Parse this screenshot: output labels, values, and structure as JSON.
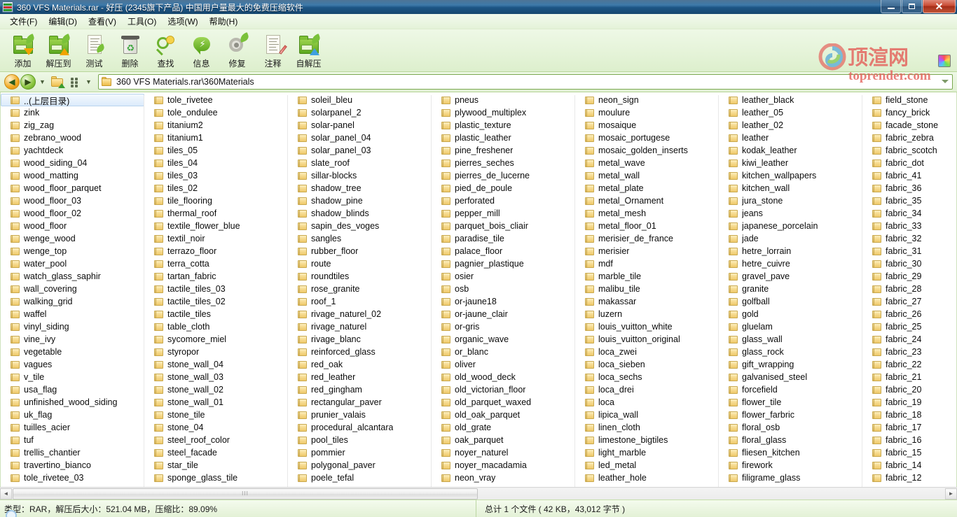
{
  "window": {
    "title": "360 VFS Materials.rar - 好压 (2345旗下产品) 中国用户量最大的免费压缩软件",
    "app_icon": "archive-icon",
    "minimize_label": "",
    "maximize_label": "",
    "close_label": "✕"
  },
  "menu": {
    "items": [
      {
        "label": "文件(F)",
        "name": "menu-file"
      },
      {
        "label": "编辑(D)",
        "name": "menu-edit"
      },
      {
        "label": "查看(V)",
        "name": "menu-view"
      },
      {
        "label": "工具(O)",
        "name": "menu-tools"
      },
      {
        "label": "选项(W)",
        "name": "menu-options"
      },
      {
        "label": "帮助(H)",
        "name": "menu-help"
      }
    ]
  },
  "toolbar": {
    "buttons": [
      {
        "label": "添加",
        "icon": "add-to-archive-icon"
      },
      {
        "label": "解压到",
        "icon": "extract-to-icon"
      },
      {
        "label": "测试",
        "icon": "test-archive-icon"
      },
      {
        "label": "删除",
        "icon": "delete-trash-icon"
      },
      {
        "label": "查找",
        "icon": "find-search-icon"
      },
      {
        "label": "信息",
        "icon": "info-icon"
      },
      {
        "label": "修复",
        "icon": "repair-gear-icon"
      },
      {
        "label": "注释",
        "icon": "comment-pencil-icon"
      },
      {
        "label": "自解压",
        "icon": "sfx-icon"
      }
    ],
    "right_icon": "color-palette-icon"
  },
  "watermark": {
    "text_cn": "顶渲网",
    "text_en": "toprender.com",
    "color": "#e4625c"
  },
  "address_bar": {
    "back_icon": "back-arrow-icon",
    "forward_icon": "forward-arrow-icon",
    "history_icon": "chevron-down-icon",
    "up_folder_icon": "up-one-level-icon",
    "view_mode_icon": "view-mode-icon",
    "path": "360 VFS Materials.rar\\360Materials",
    "dropdown_icon": "chevron-down-icon"
  },
  "file_list": {
    "columns": [
      {
        "name": "column-1",
        "items": [
          "..(上层目录)",
          "zink",
          "zig_zag",
          "zebrano_wood",
          "yachtdeck",
          "wood_siding_04",
          "wood_matting",
          "wood_floor_parquet",
          "wood_floor_03",
          "wood_floor_02",
          "wood_floor",
          "wenge_wood",
          "wenge_top",
          "water_pool",
          "watch_glass_saphir",
          "wall_covering",
          "walking_grid",
          "waffel",
          "vinyl_siding",
          "vine_ivy",
          "vegetable",
          "vagues",
          "v_tile",
          "usa_flag",
          "unfinished_wood_siding",
          "uk_flag",
          "tuilles_acier",
          "tuf",
          "trellis_chantier",
          "travertino_bianco",
          "tole_rivetee_03"
        ]
      },
      {
        "name": "column-2",
        "items": [
          "tole_rivetee",
          "tole_ondulee",
          "titanium2",
          "titanium1",
          "tiles_05",
          "tiles_04",
          "tiles_03",
          "tiles_02",
          "tile_flooring",
          "thermal_roof",
          "textile_flower_blue",
          "textil_noir",
          "terrazo_floor",
          "terra_cotta",
          "tartan_fabric",
          "tactile_tiles_03",
          "tactile_tiles_02",
          "tactile_tiles",
          "table_cloth",
          "sycomore_miel",
          "styropor",
          "stone_wall_04",
          "stone_wall_03",
          "stone_wall_02",
          "stone_wall_01",
          "stone_tile",
          "stone_04",
          "steel_roof_color",
          "steel_facade",
          "star_tile",
          "sponge_glass_tile"
        ]
      },
      {
        "name": "column-3",
        "items": [
          "soleil_bleu",
          "solarpanel_2",
          "solar-panel",
          "solar_panel_04",
          "solar_panel_03",
          "slate_roof",
          "sillar-blocks",
          "shadow_tree",
          "shadow_pine",
          "shadow_blinds",
          "sapin_des_voges",
          "sangles",
          "rubber_floor",
          "route",
          "roundtiles",
          "rose_granite",
          "roof_1",
          "rivage_naturel_02",
          "rivage_naturel",
          "rivage_blanc",
          "reinforced_glass",
          "red_oak",
          "red_leather",
          "red_gingham",
          "rectangular_paver",
          "prunier_valais",
          "procedural_alcantara",
          "pool_tiles",
          "pommier",
          "polygonal_paver",
          "poele_tefal"
        ]
      },
      {
        "name": "column-4",
        "items": [
          "pneus",
          "plywood_multiplex",
          "plastic_texture",
          "plastic_leather",
          "pine_freshener",
          "pierres_seches",
          "pierres_de_lucerne",
          "pied_de_poule",
          "perforated",
          "pepper_mill",
          "parquet_bois_cliair",
          "paradise_tile",
          "palace_floor",
          "pagnier_plastique",
          "osier",
          "osb",
          "or-jaune18",
          "or-jaune_clair",
          "or-gris",
          "organic_wave",
          "or_blanc",
          "oliver",
          "old_wood_deck",
          "old_victorian_floor",
          "old_parquet_waxed",
          "old_oak_parquet",
          "old_grate",
          "oak_parquet",
          "noyer_naturel",
          "noyer_macadamia",
          "neon_vray"
        ]
      },
      {
        "name": "column-5",
        "items": [
          "neon_sign",
          "moulure",
          "mosaique",
          "mosaic_portugese",
          "mosaic_golden_inserts",
          "metal_wave",
          "metal_wall",
          "metal_plate",
          "metal_Ornament",
          "metal_mesh",
          "metal_floor_01",
          "merisier_de_france",
          "merisier",
          "mdf",
          "marble_tile",
          "malibu_tile",
          "makassar",
          "luzern",
          "louis_vuitton_white",
          "louis_vuitton_original",
          "loca_zwei",
          "loca_sieben",
          "loca_sechs",
          "loca_drei",
          "loca",
          "lipica_wall",
          "linen_cloth",
          "limestone_bigtiles",
          "light_marble",
          "led_metal",
          "leather_hole"
        ]
      },
      {
        "name": "column-6",
        "items": [
          "leather_black",
          "leather_05",
          "leather_02",
          "leather",
          "kodak_leather",
          "kiwi_leather",
          "kitchen_wallpapers",
          "kitchen_wall",
          "jura_stone",
          "jeans",
          "japanese_porcelain",
          "jade",
          "hetre_lorrain",
          "hetre_cuivre",
          "gravel_pave",
          "granite",
          "golfball",
          "gold",
          "gluelam",
          "glass_wall",
          "glass_rock",
          "gift_wrapping",
          "galvanised_steel",
          "forcefield",
          "flower_tile",
          "flower_farbric",
          "floral_osb",
          "floral_glass",
          "fliesen_kitchen",
          "firework",
          "filigrame_glass"
        ]
      },
      {
        "name": "column-7",
        "items": [
          "field_stone",
          "fancy_brick",
          "facade_stone",
          "fabric_zebra",
          "fabric_scotch",
          "fabric_dot",
          "fabric_41",
          "fabric_36",
          "fabric_35",
          "fabric_34",
          "fabric_33",
          "fabric_32",
          "fabric_31",
          "fabric_30",
          "fabric_29",
          "fabric_28",
          "fabric_27",
          "fabric_26",
          "fabric_25",
          "fabric_24",
          "fabric_23",
          "fabric_22",
          "fabric_21",
          "fabric_20",
          "fabric_19",
          "fabric_18",
          "fabric_17",
          "fabric_16",
          "fabric_15",
          "fabric_14",
          "fabric_12"
        ]
      }
    ],
    "selected_index": 0
  },
  "scrollbar": {
    "left_arrow": "◄",
    "right_arrow": "►",
    "grip": "⦀"
  },
  "status_bar": {
    "left": "类型：RAR，解压后大小：521.04 MB，压缩比：89.09%",
    "right": "总计 1 个文件 ( 42 KB，43,012 字节 )"
  }
}
